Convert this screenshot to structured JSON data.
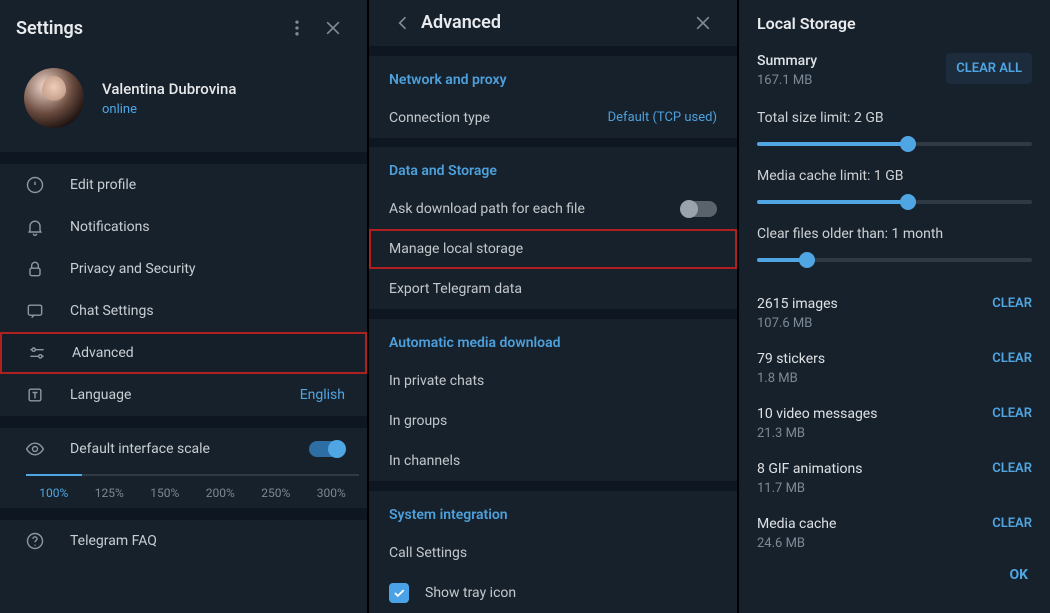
{
  "panel1": {
    "title": "Settings",
    "profile": {
      "name": "Valentina Dubrovina",
      "status": "online"
    },
    "menu": [
      {
        "icon": "profile",
        "label": "Edit profile"
      },
      {
        "icon": "bell",
        "label": "Notifications"
      },
      {
        "icon": "lock",
        "label": "Privacy and Security"
      },
      {
        "icon": "chat",
        "label": "Chat Settings"
      },
      {
        "icon": "sliders",
        "label": "Advanced",
        "highlighted": true
      },
      {
        "icon": "lang",
        "label": "Language",
        "right": "English"
      }
    ],
    "default_scale_label": "Default interface scale",
    "scale_toggle_on": true,
    "scales": [
      "100%",
      "125%",
      "150%",
      "200%",
      "250%",
      "300%"
    ],
    "scale_active": "100%",
    "faq_label": "Telegram FAQ"
  },
  "panel2": {
    "title": "Advanced",
    "sections": {
      "network": {
        "title": "Network and proxy",
        "connection_label": "Connection type",
        "connection_value": "Default (TCP used)"
      },
      "data": {
        "title": "Data and Storage",
        "ask_path": "Ask download path for each file",
        "ask_path_on": false,
        "manage": "Manage local storage",
        "export": "Export Telegram data"
      },
      "auto": {
        "title": "Automatic media download",
        "private": "In private chats",
        "groups": "In groups",
        "channels": "In channels"
      },
      "system": {
        "title": "System integration",
        "call": "Call Settings",
        "tray": "Show tray icon",
        "tray_checked": true
      }
    }
  },
  "panel3": {
    "title": "Local Storage",
    "summary_label": "Summary",
    "summary_size": "167.1 MB",
    "clear_all": "CLEAR ALL",
    "sliders": [
      {
        "label": "Total size limit: 2 GB",
        "pct": 55
      },
      {
        "label": "Media cache limit: 1 GB",
        "pct": 55
      },
      {
        "label": "Clear files older than: 1 month",
        "pct": 18
      }
    ],
    "stats": [
      {
        "title": "2615 images",
        "sub": "107.6 MB"
      },
      {
        "title": "79 stickers",
        "sub": "1.8 MB"
      },
      {
        "title": "10 video messages",
        "sub": "21.3 MB"
      },
      {
        "title": "8 GIF animations",
        "sub": "11.7 MB"
      },
      {
        "title": "Media cache",
        "sub": "24.6 MB"
      }
    ],
    "clear_label": "CLEAR",
    "ok_label": "OK"
  }
}
